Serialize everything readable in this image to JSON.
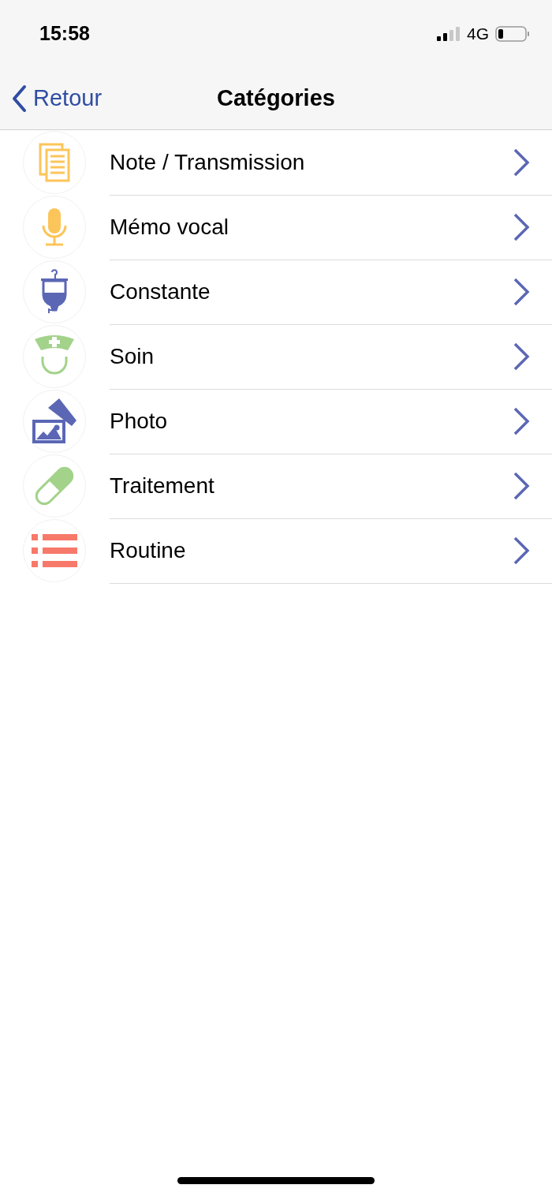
{
  "status_bar": {
    "time": "15:58",
    "network": "4G"
  },
  "nav_bar": {
    "back": "Retour",
    "title": "Catégories"
  },
  "categories": [
    {
      "kind": "notes",
      "label": "Note / Transmission"
    },
    {
      "kind": "mic",
      "label": "Mémo vocal"
    },
    {
      "kind": "drip",
      "label": "Constante"
    },
    {
      "kind": "nurse",
      "label": "Soin"
    },
    {
      "kind": "photo",
      "label": "Photo"
    },
    {
      "kind": "pill",
      "label": "Traitement"
    },
    {
      "kind": "list",
      "label": "Routine"
    }
  ]
}
